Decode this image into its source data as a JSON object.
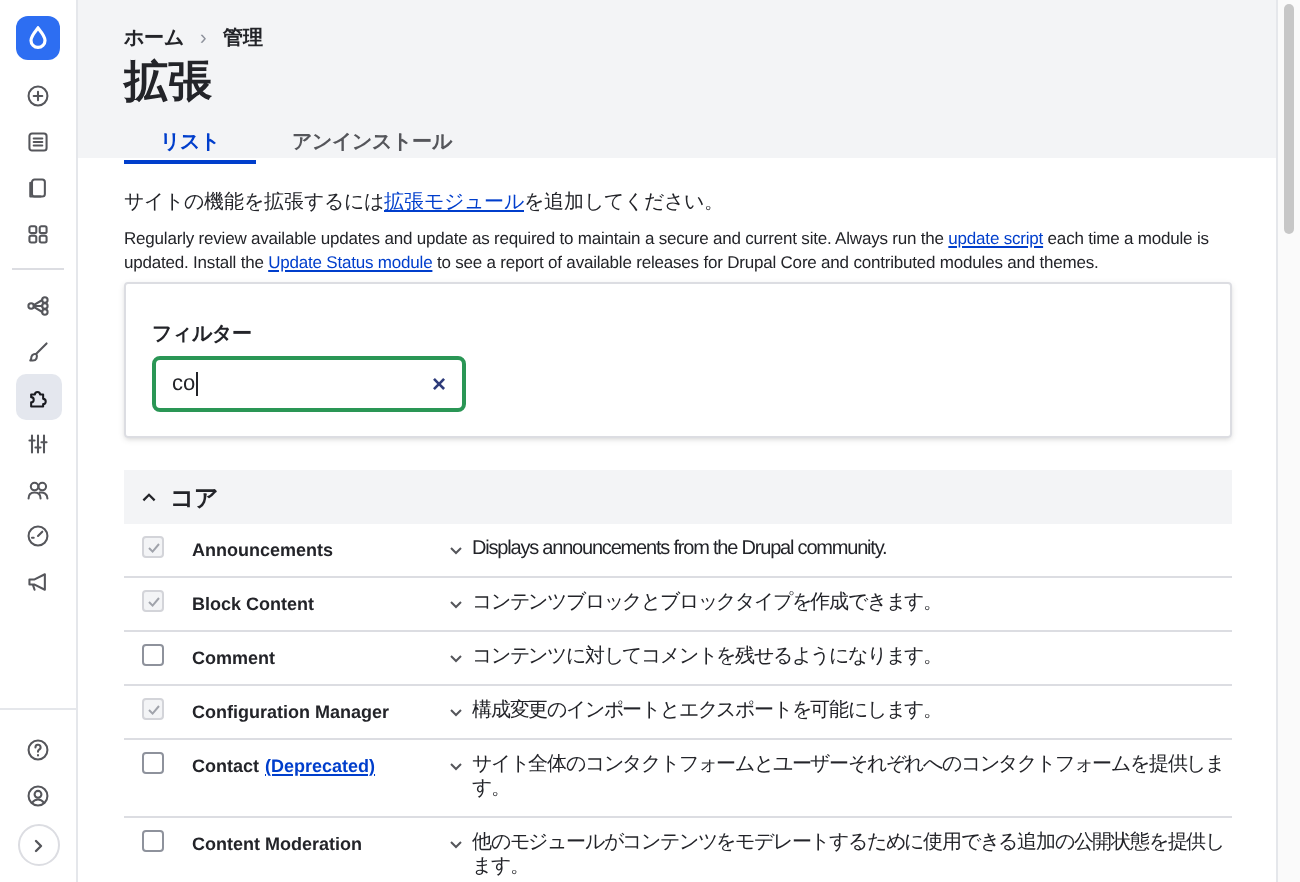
{
  "sidebar": {
    "items": [
      {
        "kind": "plus",
        "selected": false
      },
      {
        "kind": "document",
        "selected": false
      },
      {
        "kind": "copy",
        "selected": false
      },
      {
        "kind": "grid",
        "selected": false
      },
      {
        "kind": "divider"
      },
      {
        "kind": "structure",
        "selected": false
      },
      {
        "kind": "brush",
        "selected": false
      },
      {
        "kind": "puzzle",
        "selected": true
      },
      {
        "kind": "sliders",
        "selected": false
      },
      {
        "kind": "users",
        "selected": false
      },
      {
        "kind": "gauge",
        "selected": false
      },
      {
        "kind": "megaphone",
        "selected": false
      }
    ],
    "bottom_items": [
      {
        "kind": "help"
      },
      {
        "kind": "user"
      },
      {
        "kind": "expand"
      }
    ]
  },
  "breadcrumb": [
    "ホーム",
    "›",
    "管理"
  ],
  "title": "拡張",
  "tabs": [
    {
      "label": "リスト",
      "selected": true
    },
    {
      "label": "アンインストール",
      "selected": false
    }
  ],
  "intro": [
    {
      "text": "サイトの機能を拡張するには"
    },
    {
      "text": "拡張モジュール",
      "link": true
    },
    {
      "text": "を追加してください。"
    }
  ],
  "notice": [
    {
      "text": "Regularly review available updates and update as required to maintain a secure and current site. Always run the "
    },
    {
      "text": "update script",
      "link": true
    },
    {
      "text": " each time a module is updated. Install the "
    },
    {
      "text": "Update Status module",
      "link": true
    },
    {
      "text": " to see a report of available releases for Drupal Core and contributed modules and themes."
    }
  ],
  "filter": {
    "label": "フィルター",
    "value": "co",
    "clear": "×"
  },
  "section": {
    "title": "コア",
    "expanded": true,
    "modules": [
      {
        "name": "Announcements",
        "checked": true,
        "disabled": true,
        "description": "Displays announcements from the Drupal community."
      },
      {
        "name": "Block Content",
        "checked": true,
        "disabled": true,
        "description": "コンテンツブロックとブロックタイプを作成できます。"
      },
      {
        "name": "Comment",
        "checked": false,
        "disabled": false,
        "description": "コンテンツに対してコメントを残せるようになります。"
      },
      {
        "name": "Configuration Manager",
        "checked": true,
        "disabled": true,
        "description": "構成変更のインポートとエクスポートを可能にします。"
      },
      {
        "name": "Contact",
        "badge": "(Deprecated)",
        "checked": false,
        "disabled": false,
        "description": "サイト全体のコンタクトフォームとユーザーそれぞれへのコンタクトフォームを提供します。"
      },
      {
        "name": "Content Moderation",
        "checked": false,
        "disabled": false,
        "description": "他のモジュールがコンテンツをモデレートするために使用できる追加の公開状態を提供します。"
      }
    ]
  }
}
